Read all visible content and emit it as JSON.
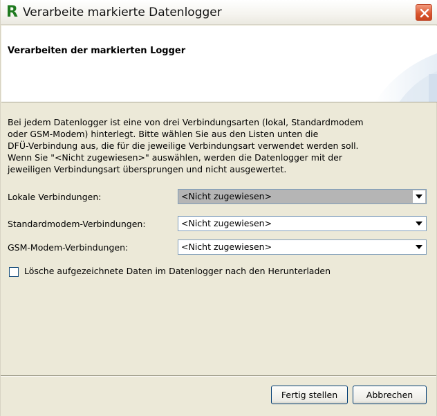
{
  "window": {
    "title": "Verarbeite markierte Datenlogger",
    "app_icon_letter": "R",
    "icon": "r-app-icon",
    "close_icon": "close-icon"
  },
  "header": {
    "title": "Verarbeiten der markierten Logger"
  },
  "description": {
    "line1": "Bei jedem Datenlogger ist eine von drei Verbindungsarten (lokal, Standardmodem",
    "line2": "oder GSM-Modem) hinterlegt. Bitte wählen Sie aus den Listen unten die",
    "line3": "DFÜ-Verbindung aus, die für die jeweilige Verbindungsart verwendet werden soll.",
    "line4": "Wenn Sie \"<Nicht zugewiesen>\" auswählen, werden die Datenlogger mit der",
    "line5": "jeweiligen Verbindungsart übersprungen und nicht ausgewertet."
  },
  "connections": [
    {
      "label": "Lokale Verbindungen:",
      "value": "<Nicht zugewiesen>"
    },
    {
      "label": "Standardmodem-Verbindungen:",
      "value": "<Nicht zugewiesen>"
    },
    {
      "label": "GSM-Modem-Verbindungen:",
      "value": "<Nicht zugewiesen>"
    }
  ],
  "options": {
    "delete_after_download_label": "Lösche aufgezeichnete Daten im Datenlogger nach den Herunterladen",
    "delete_after_download_checked": false
  },
  "buttons": {
    "finish": "Fertig stellen",
    "cancel": "Abbrechen"
  },
  "colors": {
    "dialog_background": "#ece9d8",
    "combo_selected": "#b5b5b5",
    "close_button": "#d9532c",
    "app_icon": "#1f7a1f"
  }
}
